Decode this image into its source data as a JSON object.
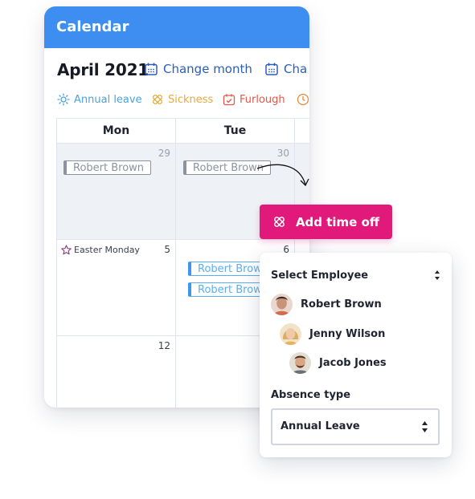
{
  "calendar": {
    "title": "Calendar",
    "month": "April 2021",
    "change_month": "Change month",
    "change_other": "Cha",
    "legend": [
      {
        "label": "Annual leave",
        "color": "#4aa3df"
      },
      {
        "label": "Sickness",
        "color": "#e8a93a"
      },
      {
        "label": "Furlough",
        "color": "#e4574a"
      }
    ],
    "days": [
      "Mon",
      "Tue"
    ],
    "week1": {
      "mon_num": "29",
      "tue_num": "30",
      "mon_chip": "Robert Brown",
      "tue_chip": "Robert Brown"
    },
    "week2": {
      "holiday": "Easter Monday",
      "mon_num": "5",
      "tue_num": "6",
      "chip1": "Robert Brown",
      "chip2": "Robert Brown"
    },
    "week3": {
      "mon_num": "12"
    }
  },
  "popup": {
    "add_button": "Add time off",
    "select_employee": "Select Employee",
    "employees": [
      {
        "name": "Robert Brown"
      },
      {
        "name": "Jenny Wilson"
      },
      {
        "name": "Jacob Jones"
      }
    ],
    "absence_type_label": "Absence type",
    "absence_type_value": "Annual Leave"
  },
  "colors": {
    "header_blue": "#3d8ef0",
    "accent_pink": "#e0197a",
    "link_blue": "#2c5db8"
  }
}
